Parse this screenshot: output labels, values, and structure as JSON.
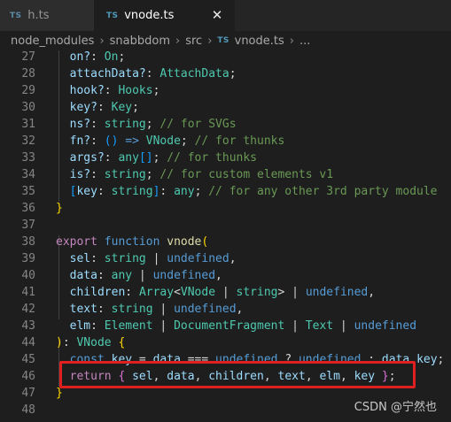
{
  "tabs": [
    {
      "badge": "TS",
      "label": "h.ts",
      "active": false
    },
    {
      "badge": "TS",
      "label": "vnode.ts",
      "active": true,
      "close_glyph": "✕"
    }
  ],
  "breadcrumb": {
    "items": [
      "node_modules",
      "snabbdom",
      "src"
    ],
    "file_badge": "TS",
    "file": "vnode.ts",
    "tail": "...",
    "separator": "›"
  },
  "watermark": "CSDN @宁然也",
  "colors": {
    "keyword": "#569cd6",
    "control": "#c586c0",
    "function": "#dcdcaa",
    "variable": "#9cdcfe",
    "type": "#4ec9b0",
    "comment": "#6a9955",
    "highlight_border": "#e02020"
  },
  "code_lines": [
    {
      "n": "27",
      "tokens": [
        [
          "var",
          "  on?"
        ],
        [
          "txt",
          ": "
        ],
        [
          "type",
          "On"
        ],
        [
          "txt",
          ";"
        ]
      ]
    },
    {
      "n": "28",
      "tokens": [
        [
          "var",
          "  attachData?"
        ],
        [
          "txt",
          ": "
        ],
        [
          "type",
          "AttachData"
        ],
        [
          "txt",
          ";"
        ]
      ]
    },
    {
      "n": "29",
      "tokens": [
        [
          "var",
          "  hook?"
        ],
        [
          "txt",
          ": "
        ],
        [
          "type",
          "Hooks"
        ],
        [
          "txt",
          ";"
        ]
      ]
    },
    {
      "n": "30",
      "tokens": [
        [
          "var",
          "  key?"
        ],
        [
          "txt",
          ": "
        ],
        [
          "type",
          "Key"
        ],
        [
          "txt",
          ";"
        ]
      ]
    },
    {
      "n": "31",
      "tokens": [
        [
          "var",
          "  ns?"
        ],
        [
          "txt",
          ": "
        ],
        [
          "type",
          "string"
        ],
        [
          "txt",
          "; "
        ],
        [
          "cmt",
          "// for SVGs"
        ]
      ]
    },
    {
      "n": "32",
      "tokens": [
        [
          "var",
          "  fn?"
        ],
        [
          "txt",
          ": "
        ],
        [
          "br3",
          "()"
        ],
        [
          "txt",
          " "
        ],
        [
          "kw",
          "=>"
        ],
        [
          "txt",
          " "
        ],
        [
          "type",
          "VNode"
        ],
        [
          "txt",
          "; "
        ],
        [
          "cmt",
          "// for thunks"
        ]
      ]
    },
    {
      "n": "33",
      "tokens": [
        [
          "var",
          "  args?"
        ],
        [
          "txt",
          ": "
        ],
        [
          "type",
          "any"
        ],
        [
          "br3",
          "[]"
        ],
        [
          "txt",
          "; "
        ],
        [
          "cmt",
          "// for thunks"
        ]
      ]
    },
    {
      "n": "34",
      "tokens": [
        [
          "var",
          "  is?"
        ],
        [
          "txt",
          ": "
        ],
        [
          "type",
          "string"
        ],
        [
          "txt",
          "; "
        ],
        [
          "cmt",
          "// for custom elements v1"
        ]
      ]
    },
    {
      "n": "35",
      "tokens": [
        [
          "br3",
          "  ["
        ],
        [
          "var",
          "key"
        ],
        [
          "txt",
          ": "
        ],
        [
          "type",
          "string"
        ],
        [
          "br3",
          "]"
        ],
        [
          "txt",
          ": "
        ],
        [
          "type",
          "any"
        ],
        [
          "txt",
          "; "
        ],
        [
          "cmt",
          "// for any other 3rd party module"
        ]
      ]
    },
    {
      "n": "36",
      "tokens": [
        [
          "br",
          "}"
        ]
      ]
    },
    {
      "n": "37",
      "tokens": []
    },
    {
      "n": "38",
      "tokens": [
        [
          "ctl",
          "export"
        ],
        [
          "txt",
          " "
        ],
        [
          "kw",
          "function"
        ],
        [
          "txt",
          " "
        ],
        [
          "fn",
          "vnode"
        ],
        [
          "br",
          "("
        ]
      ]
    },
    {
      "n": "39",
      "tokens": [
        [
          "var",
          "  sel"
        ],
        [
          "txt",
          ": "
        ],
        [
          "type",
          "string"
        ],
        [
          "txt",
          " | "
        ],
        [
          "kw",
          "undefined"
        ],
        [
          "txt",
          ","
        ]
      ]
    },
    {
      "n": "40",
      "tokens": [
        [
          "var",
          "  data"
        ],
        [
          "txt",
          ": "
        ],
        [
          "type",
          "any"
        ],
        [
          "txt",
          " | "
        ],
        [
          "kw",
          "undefined"
        ],
        [
          "txt",
          ","
        ]
      ]
    },
    {
      "n": "41",
      "tokens": [
        [
          "var",
          "  children"
        ],
        [
          "txt",
          ": "
        ],
        [
          "type",
          "Array"
        ],
        [
          "txt",
          "<"
        ],
        [
          "type",
          "VNode"
        ],
        [
          "txt",
          " | "
        ],
        [
          "type",
          "string"
        ],
        [
          "txt",
          "> | "
        ],
        [
          "kw",
          "undefined"
        ],
        [
          "txt",
          ","
        ]
      ]
    },
    {
      "n": "42",
      "tokens": [
        [
          "var",
          "  text"
        ],
        [
          "txt",
          ": "
        ],
        [
          "type",
          "string"
        ],
        [
          "txt",
          " | "
        ],
        [
          "kw",
          "undefined"
        ],
        [
          "txt",
          ","
        ]
      ]
    },
    {
      "n": "43",
      "tokens": [
        [
          "var",
          "  elm"
        ],
        [
          "txt",
          ": "
        ],
        [
          "type",
          "Element"
        ],
        [
          "txt",
          " | "
        ],
        [
          "type",
          "DocumentFragment"
        ],
        [
          "txt",
          " | "
        ],
        [
          "type",
          "Text"
        ],
        [
          "txt",
          " | "
        ],
        [
          "kw",
          "undefined"
        ]
      ]
    },
    {
      "n": "44",
      "tokens": [
        [
          "br",
          ")"
        ],
        [
          "txt",
          ": "
        ],
        [
          "type",
          "VNode"
        ],
        [
          "txt",
          " "
        ],
        [
          "br",
          "{"
        ]
      ]
    },
    {
      "n": "45",
      "tokens": [
        [
          "kw",
          "  const"
        ],
        [
          "txt",
          " "
        ],
        [
          "var",
          "key"
        ],
        [
          "txt",
          " = "
        ],
        [
          "var",
          "data"
        ],
        [
          "txt",
          " === "
        ],
        [
          "kw",
          "undefined"
        ],
        [
          "txt",
          " ? "
        ],
        [
          "kw",
          "undefined"
        ],
        [
          "txt",
          " : "
        ],
        [
          "var",
          "data"
        ],
        [
          "txt",
          "."
        ],
        [
          "var",
          "key"
        ],
        [
          "txt",
          ";"
        ]
      ]
    },
    {
      "n": "46",
      "tokens": [
        [
          "ctl",
          "  return"
        ],
        [
          "txt",
          " "
        ],
        [
          "br2",
          "{"
        ],
        [
          "txt",
          " "
        ],
        [
          "var",
          "sel"
        ],
        [
          "txt",
          ", "
        ],
        [
          "var",
          "data"
        ],
        [
          "txt",
          ", "
        ],
        [
          "var",
          "children"
        ],
        [
          "txt",
          ", "
        ],
        [
          "var",
          "text"
        ],
        [
          "txt",
          ", "
        ],
        [
          "var",
          "elm"
        ],
        [
          "txt",
          ", "
        ],
        [
          "var",
          "key"
        ],
        [
          "txt",
          " "
        ],
        [
          "br2",
          "}"
        ],
        [
          "txt",
          ";"
        ]
      ]
    },
    {
      "n": "47",
      "tokens": [
        [
          "br",
          "}"
        ]
      ]
    },
    {
      "n": "48",
      "tokens": []
    }
  ]
}
